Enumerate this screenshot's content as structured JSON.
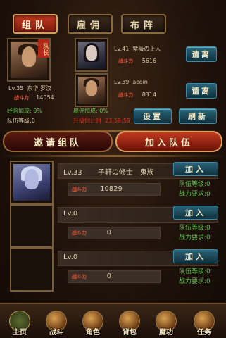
{
  "tabs": [
    {
      "label": "组队"
    },
    {
      "label": "雇佣"
    },
    {
      "label": "布阵"
    }
  ],
  "leader": {
    "badge": "队长",
    "level": "Lv.35",
    "name": "东华|罗汉",
    "power_label": "战斗力",
    "power": "14054",
    "exp_bonus": "经验加成: 0%",
    "team_level": "队伍等级:0"
  },
  "members": [
    {
      "level": "Lv.41",
      "name": "紫薇の上人",
      "power_label": "战斗力",
      "power": "5616",
      "kick": "请离"
    },
    {
      "level": "Lv.39",
      "name": "acoin",
      "power_label": "战斗力",
      "power": "8314",
      "kick": "请离"
    }
  ],
  "stats": {
    "mercenary_bonus": "雇佣加成: 0%",
    "upgrade_countdown": "升级倒计时",
    "countdown_value": "23:59:59"
  },
  "buttons": {
    "settings": "设置",
    "refresh": "刷新",
    "invite": "邀请组队",
    "join": "加入队伍"
  },
  "teams": [
    {
      "level": "Lv.33",
      "leader": "子轩の修士",
      "race": "鬼族",
      "power_label": "战斗力",
      "power": "10829",
      "join": "加入",
      "req_level": "队伍等级:0",
      "req_power": "战力要求:0"
    },
    {
      "level": "Lv.0",
      "leader": "",
      "race": "",
      "power_label": "战斗力",
      "power": "0",
      "join": "加入",
      "req_level": "队伍等级:0",
      "req_power": "战力要求:0"
    },
    {
      "level": "Lv.0",
      "leader": "",
      "race": "",
      "power_label": "战斗力",
      "power": "0",
      "join": "加入",
      "req_level": "队伍等级:0",
      "req_power": "战力要求:0"
    }
  ],
  "nav": [
    {
      "label": "主页",
      "icon": "home-icon"
    },
    {
      "label": "战斗",
      "icon": "battle-icon"
    },
    {
      "label": "角色",
      "icon": "character-icon"
    },
    {
      "label": "背包",
      "icon": "bag-icon"
    },
    {
      "label": "魔功",
      "icon": "magic-icon"
    },
    {
      "label": "任务",
      "icon": "quest-icon"
    }
  ],
  "colors": {
    "accent_red": "#c23a20",
    "accent_teal": "#2a6478",
    "gold": "#e8b040",
    "green": "#60c050"
  }
}
